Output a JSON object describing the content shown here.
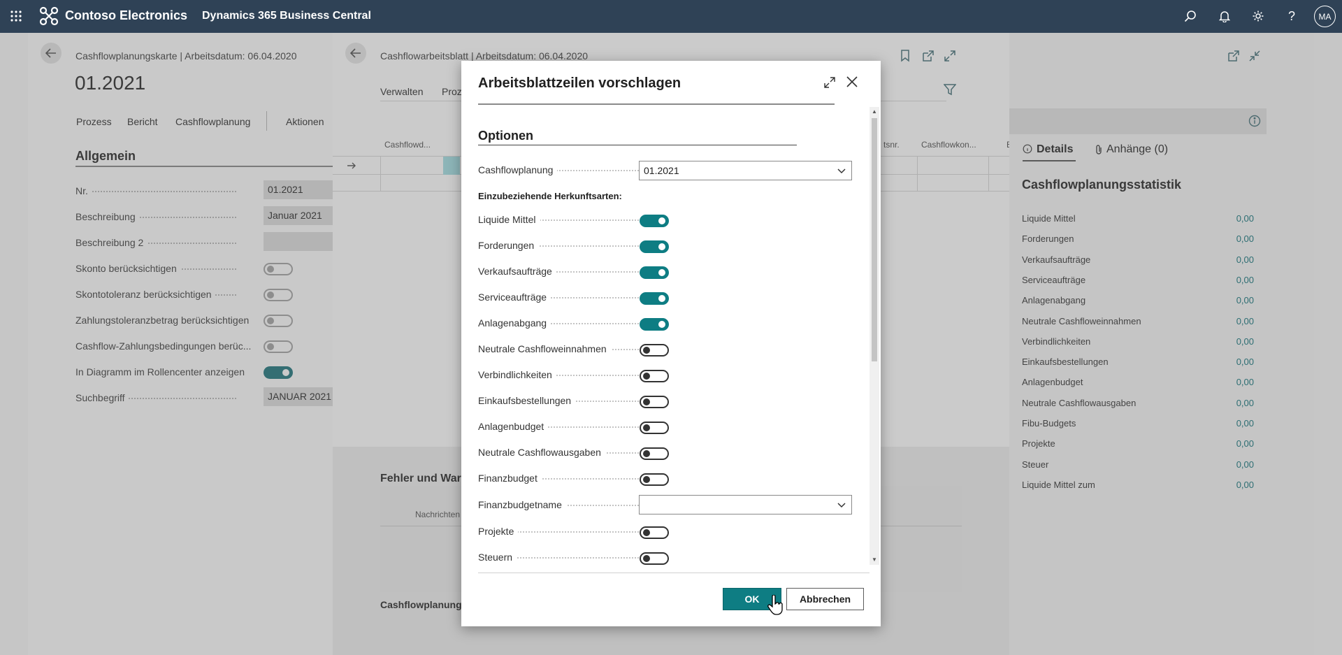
{
  "topbar": {
    "brand": "Contoso Electronics",
    "product": "Dynamics 365 Business Central",
    "avatar": "MA",
    "icons": [
      "app-launcher-icon",
      "search-icon",
      "bell-icon",
      "gear-icon",
      "help-icon"
    ]
  },
  "card": {
    "breadcrumb": "Cashflowplanungskarte | Arbeitsdatum: 06.04.2020",
    "title": "01.2021",
    "actions": [
      "Prozess",
      "Bericht",
      "Cashflowplanung",
      "Aktionen"
    ],
    "section": "Allgemein",
    "fields": [
      {
        "label": "Nr.",
        "value": "01.2021"
      },
      {
        "label": "Beschreibung",
        "value": "Januar 2021"
      },
      {
        "label": "Beschreibung 2",
        "value": ""
      },
      {
        "label": "Skonto berücksichtigen",
        "toggle": false
      },
      {
        "label": "Skontotoleranz berücksichtigen",
        "toggle": false
      },
      {
        "label": "Zahlungstoleranzbetrag berücksichtigen",
        "toggle": false
      },
      {
        "label": "Cashflow-Zahlungsbedingungen berüc...",
        "toggle": false
      },
      {
        "label": "In Diagramm im Rollencenter anzeigen",
        "toggle": true
      },
      {
        "label": "Suchbegriff",
        "value": "JANUAR 2021"
      }
    ]
  },
  "worksheet": {
    "breadcrumb": "Cashflowarbeitsblatt | Arbeitsdatum: 06.04.2020",
    "menu": [
      "Verwalten",
      "Proz"
    ],
    "columns": [
      "Cashflowd...",
      "tsnr.",
      "Cashflowkon...",
      "B"
    ],
    "errors_title": "Fehler und Warn",
    "messages_col": "Nachrichten",
    "bottom_label": "Cashflowplanungs"
  },
  "factbox": {
    "tabs": [
      "Details",
      "Anhänge (0)"
    ],
    "title": "Cashflowplanungsstatistik",
    "rows": [
      {
        "label": "Liquide Mittel",
        "value": "0,00"
      },
      {
        "label": "Forderungen",
        "value": "0,00"
      },
      {
        "label": "Verkaufsaufträge",
        "value": "0,00"
      },
      {
        "label": "Serviceaufträge",
        "value": "0,00"
      },
      {
        "label": "Anlagenabgang",
        "value": "0,00"
      },
      {
        "label": "Neutrale Cashfloweinnahmen",
        "value": "0,00"
      },
      {
        "label": "Verbindlichkeiten",
        "value": "0,00"
      },
      {
        "label": "Einkaufsbestellungen",
        "value": "0,00"
      },
      {
        "label": "Anlagenbudget",
        "value": "0,00"
      },
      {
        "label": "Neutrale Cashflowausgaben",
        "value": "0,00"
      },
      {
        "label": "Fibu-Budgets",
        "value": "0,00"
      },
      {
        "label": "Projekte",
        "value": "0,00"
      },
      {
        "label": "Steuer",
        "value": "0,00"
      },
      {
        "label": "Liquide Mittel zum",
        "value": "0,00"
      }
    ]
  },
  "dialog": {
    "title": "Arbeitsblattzeilen vorschlagen",
    "section": "Optionen",
    "cashflow_label": "Cashflowplanung",
    "cashflow_value": "01.2021",
    "subhead": "Einzubeziehende Herkunftsarten:",
    "toggles": [
      {
        "label": "Liquide Mittel",
        "on": true
      },
      {
        "label": "Forderungen",
        "on": true
      },
      {
        "label": "Verkaufsaufträge",
        "on": true
      },
      {
        "label": "Serviceaufträge",
        "on": true
      },
      {
        "label": "Anlagenabgang",
        "on": true
      },
      {
        "label": "Neutrale Cashfloweinnahmen",
        "on": false
      },
      {
        "label": "Verbindlichkeiten",
        "on": false
      },
      {
        "label": "Einkaufsbestellungen",
        "on": false
      },
      {
        "label": "Anlagenbudget",
        "on": false
      },
      {
        "label": "Neutrale Cashflowausgaben",
        "on": false
      },
      {
        "label": "Finanzbudget",
        "on": false
      }
    ],
    "budgetname_label": "Finanzbudgetname",
    "budgetname_value": "",
    "toggles2": [
      {
        "label": "Projekte",
        "on": false
      },
      {
        "label": "Steuern",
        "on": false
      }
    ],
    "ok": "OK",
    "cancel": "Abbrechen"
  }
}
